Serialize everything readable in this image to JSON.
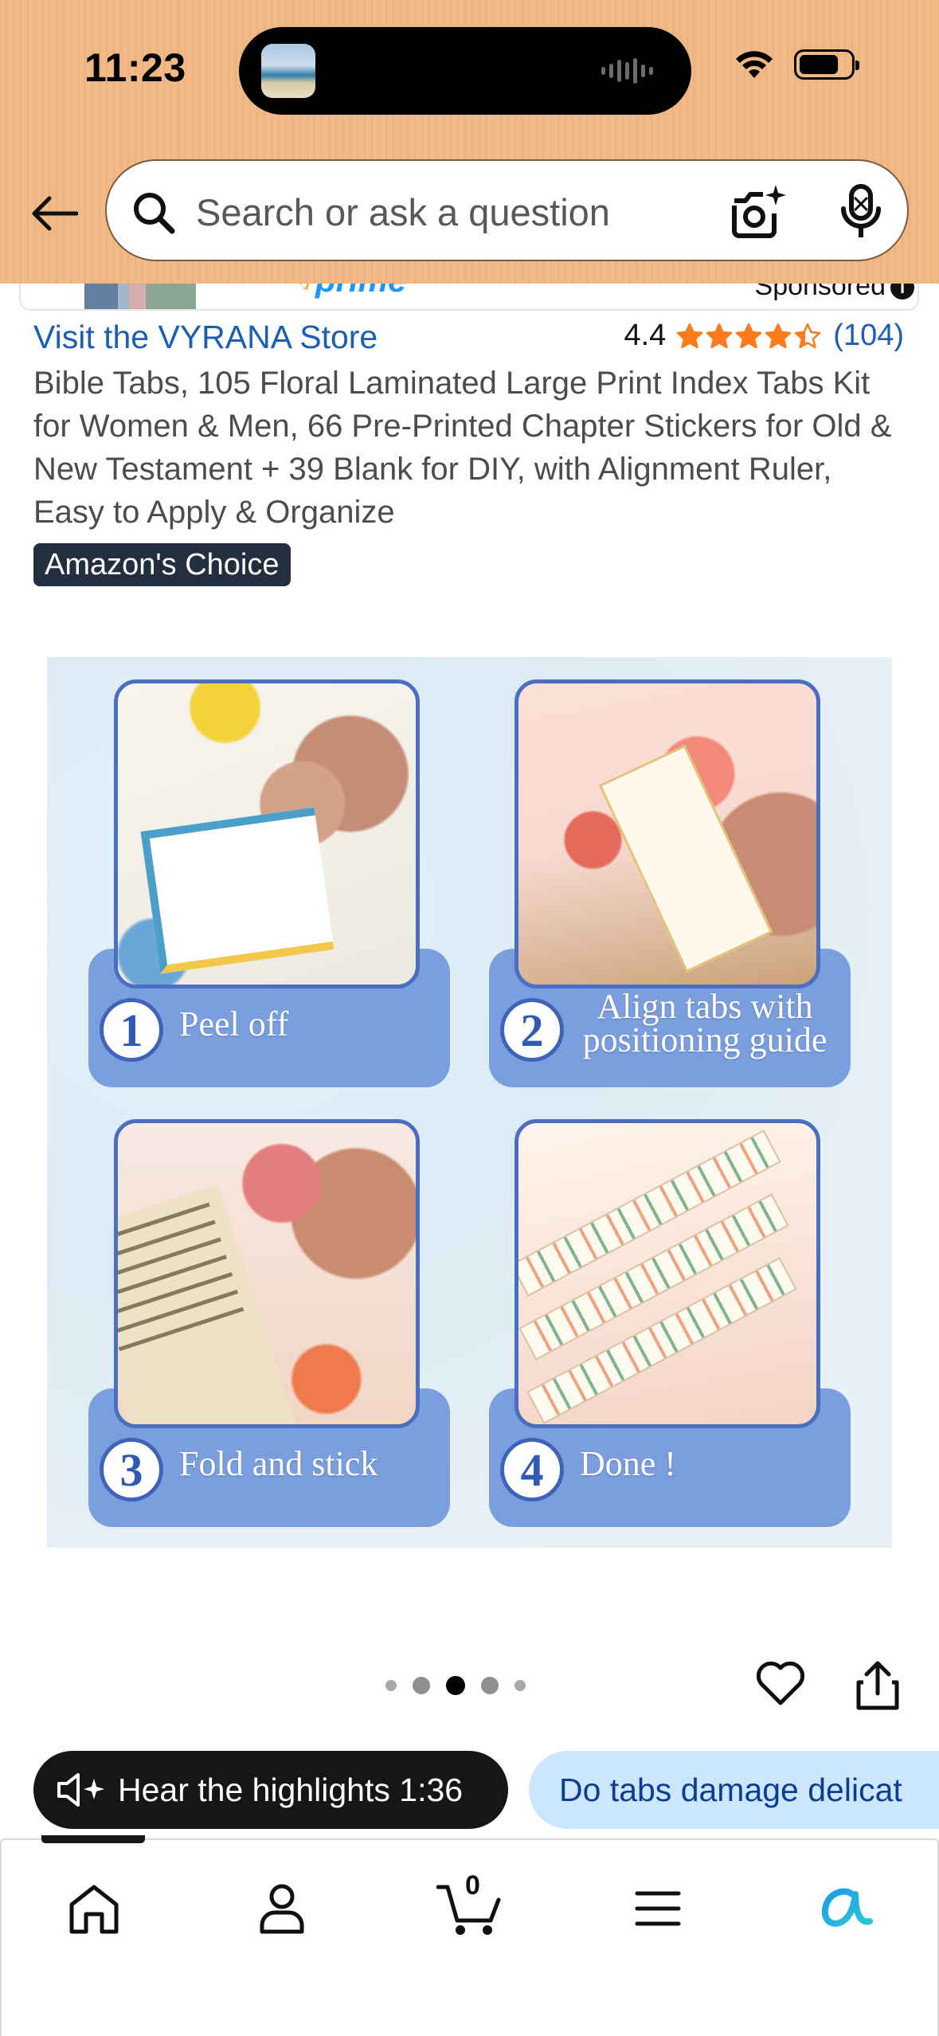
{
  "status_bar": {
    "time": "11:23"
  },
  "header": {
    "search_placeholder": "Search or ask a question"
  },
  "sponsored": {
    "label": "Sponsored",
    "info_glyph": "i"
  },
  "product": {
    "store_link": "Visit the VYRANA Store",
    "rating_value": "4.4",
    "rating": 4.4,
    "review_count": "(104)",
    "title": "Bible Tabs, 105 Floral Laminated Large Print Index Tabs Kit for Women & Men, 66 Pre-Printed Chapter Stickers for Old & New Testament + 39 Blank for DIY, with Alignment Ruler, Easy to Apply & Organize",
    "badge": "Amazon's Choice"
  },
  "product_image": {
    "steps": [
      {
        "number": "1",
        "text": "Peel off"
      },
      {
        "number": "2",
        "text": "Align tabs with positioning guide"
      },
      {
        "number": "3",
        "text": "Fold and stick"
      },
      {
        "number": "4",
        "text": "Done !"
      }
    ]
  },
  "carousel": {
    "total": 5,
    "active_index": 2
  },
  "chips": {
    "highlights_label": "Hear the highlights 1:36",
    "question_label": "Do tabs damage delicat"
  },
  "bottom_nav": {
    "items": [
      "home-icon",
      "account-icon",
      "cart-icon",
      "menu-icon",
      "rufus-icon"
    ],
    "cart_count": "0"
  },
  "colors": {
    "header_bg": "#f0b985",
    "link": "#1a5fb4",
    "star": "#ff7a1a",
    "badge_bg": "#232f3e",
    "step_banner": "#7b9fde",
    "chip_dark": "#161616",
    "chip_light": "#cde6ff"
  }
}
